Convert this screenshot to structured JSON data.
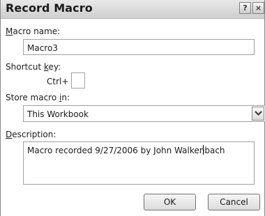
{
  "dialog": {
    "title": "Record Macro",
    "help_icon": "?",
    "close_icon": "×"
  },
  "macro_name": {
    "label_first": "M",
    "label_rest": "acro name:",
    "value": "Macro3"
  },
  "shortcut": {
    "label_pre": "Shortcut ",
    "label_accel": "k",
    "label_post": "ey:",
    "prefix": "Ctrl+",
    "value": ""
  },
  "store": {
    "label_pre": "Store macro ",
    "label_accel": "i",
    "label_post": "n:",
    "selected": "This Workbook",
    "arrow_icon": "chevron-down-icon"
  },
  "description": {
    "label_first": "D",
    "label_rest": "escription:",
    "value": "Macro recorded 9/27/2006 by John Walkenbach"
  },
  "buttons": {
    "ok": "OK",
    "cancel": "Cancel"
  }
}
